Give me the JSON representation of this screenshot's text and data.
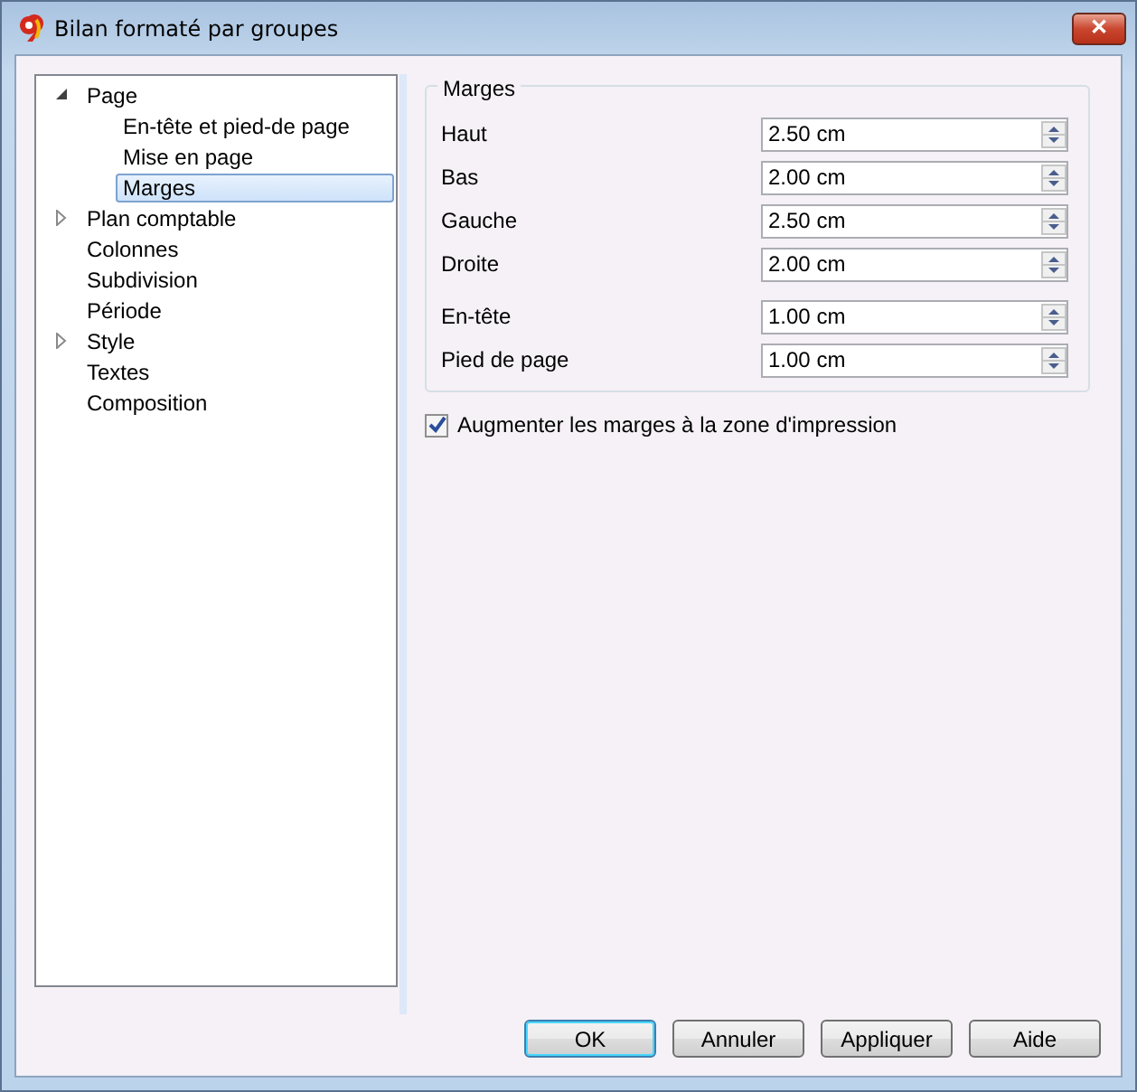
{
  "window": {
    "title": "Bilan formaté par groupes",
    "close": "✕"
  },
  "tree": [
    {
      "label": "Page",
      "expanded": true,
      "selected": false,
      "children": [
        {
          "label": "En-tête et pied-de page",
          "selected": false
        },
        {
          "label": "Mise en page",
          "selected": false
        },
        {
          "label": "Marges",
          "selected": true
        }
      ]
    },
    {
      "label": "Plan comptable",
      "expanded": false,
      "selected": false
    },
    {
      "label": "Colonnes",
      "selected": false
    },
    {
      "label": "Subdivision",
      "selected": false
    },
    {
      "label": "Période",
      "selected": false
    },
    {
      "label": "Style",
      "expanded": false,
      "selected": false
    },
    {
      "label": "Textes",
      "selected": false
    },
    {
      "label": "Composition",
      "selected": false
    }
  ],
  "group": {
    "title": "Marges",
    "field_groups": [
      [
        {
          "label": "Haut",
          "value": "2.50 cm"
        },
        {
          "label": "Bas",
          "value": "2.00 cm"
        },
        {
          "label": "Gauche",
          "value": "2.50 cm"
        },
        {
          "label": "Droite",
          "value": "2.00 cm"
        }
      ],
      [
        {
          "label": "En-tête",
          "value": "1.00 cm"
        },
        {
          "label": "Pied de page",
          "value": "1.00 cm"
        }
      ]
    ]
  },
  "checkbox": {
    "label": "Augmenter les marges à la zone d'impression",
    "checked": true
  },
  "buttons": [
    {
      "label": "OK",
      "default": true
    },
    {
      "label": "Annuler",
      "default": false
    },
    {
      "label": "Appliquer",
      "default": false
    },
    {
      "label": "Aide",
      "default": false
    }
  ]
}
